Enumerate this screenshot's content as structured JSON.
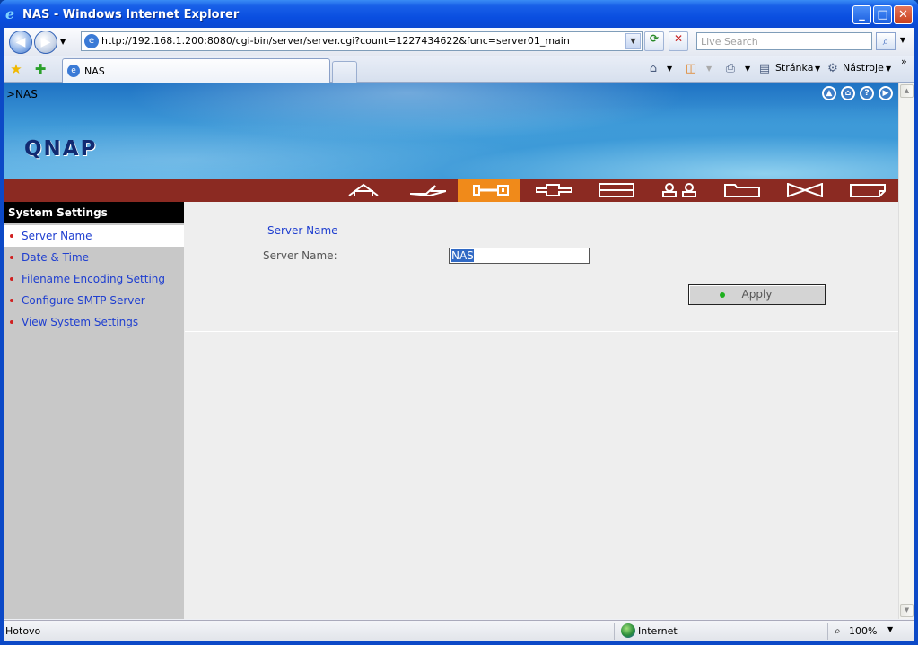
{
  "window": {
    "title": "NAS - Windows Internet Explorer"
  },
  "browser": {
    "address": "http://192.168.1.200:8080/cgi-bin/server/server.cgi?count=1227434622&func=server01_main",
    "search_placeholder": "Live Search",
    "tab_title": "NAS",
    "cmd_page": "Stránka",
    "cmd_tools": "Nástroje"
  },
  "page": {
    "breadcrumb": ">NAS",
    "logo": "QNAP",
    "menu_icons": [
      "home-menu-icon",
      "network-menu-icon",
      "system-tools-menu-icon",
      "device-config-menu-icon",
      "disk-menu-icon",
      "users-menu-icon",
      "folder-menu-icon",
      "services-menu-icon",
      "logs-menu-icon"
    ],
    "menu_active_index": 2
  },
  "sidebar": {
    "heading": "System Settings",
    "items": [
      {
        "label": "Server Name"
      },
      {
        "label": "Date & Time"
      },
      {
        "label": "Filename Encoding Setting"
      },
      {
        "label": "Configure SMTP Server"
      },
      {
        "label": "View System Settings"
      }
    ]
  },
  "main": {
    "section_title": "Server Name",
    "server_name_label": "Server Name:",
    "server_name_value": "NAS",
    "apply_label": "Apply"
  },
  "status": {
    "left": "Hotovo",
    "zone": "Internet",
    "zoom": "100%"
  },
  "colors": {
    "menu_bar": "#8b2a22",
    "menu_active": "#f08a1a",
    "link": "#1f3fd0"
  }
}
